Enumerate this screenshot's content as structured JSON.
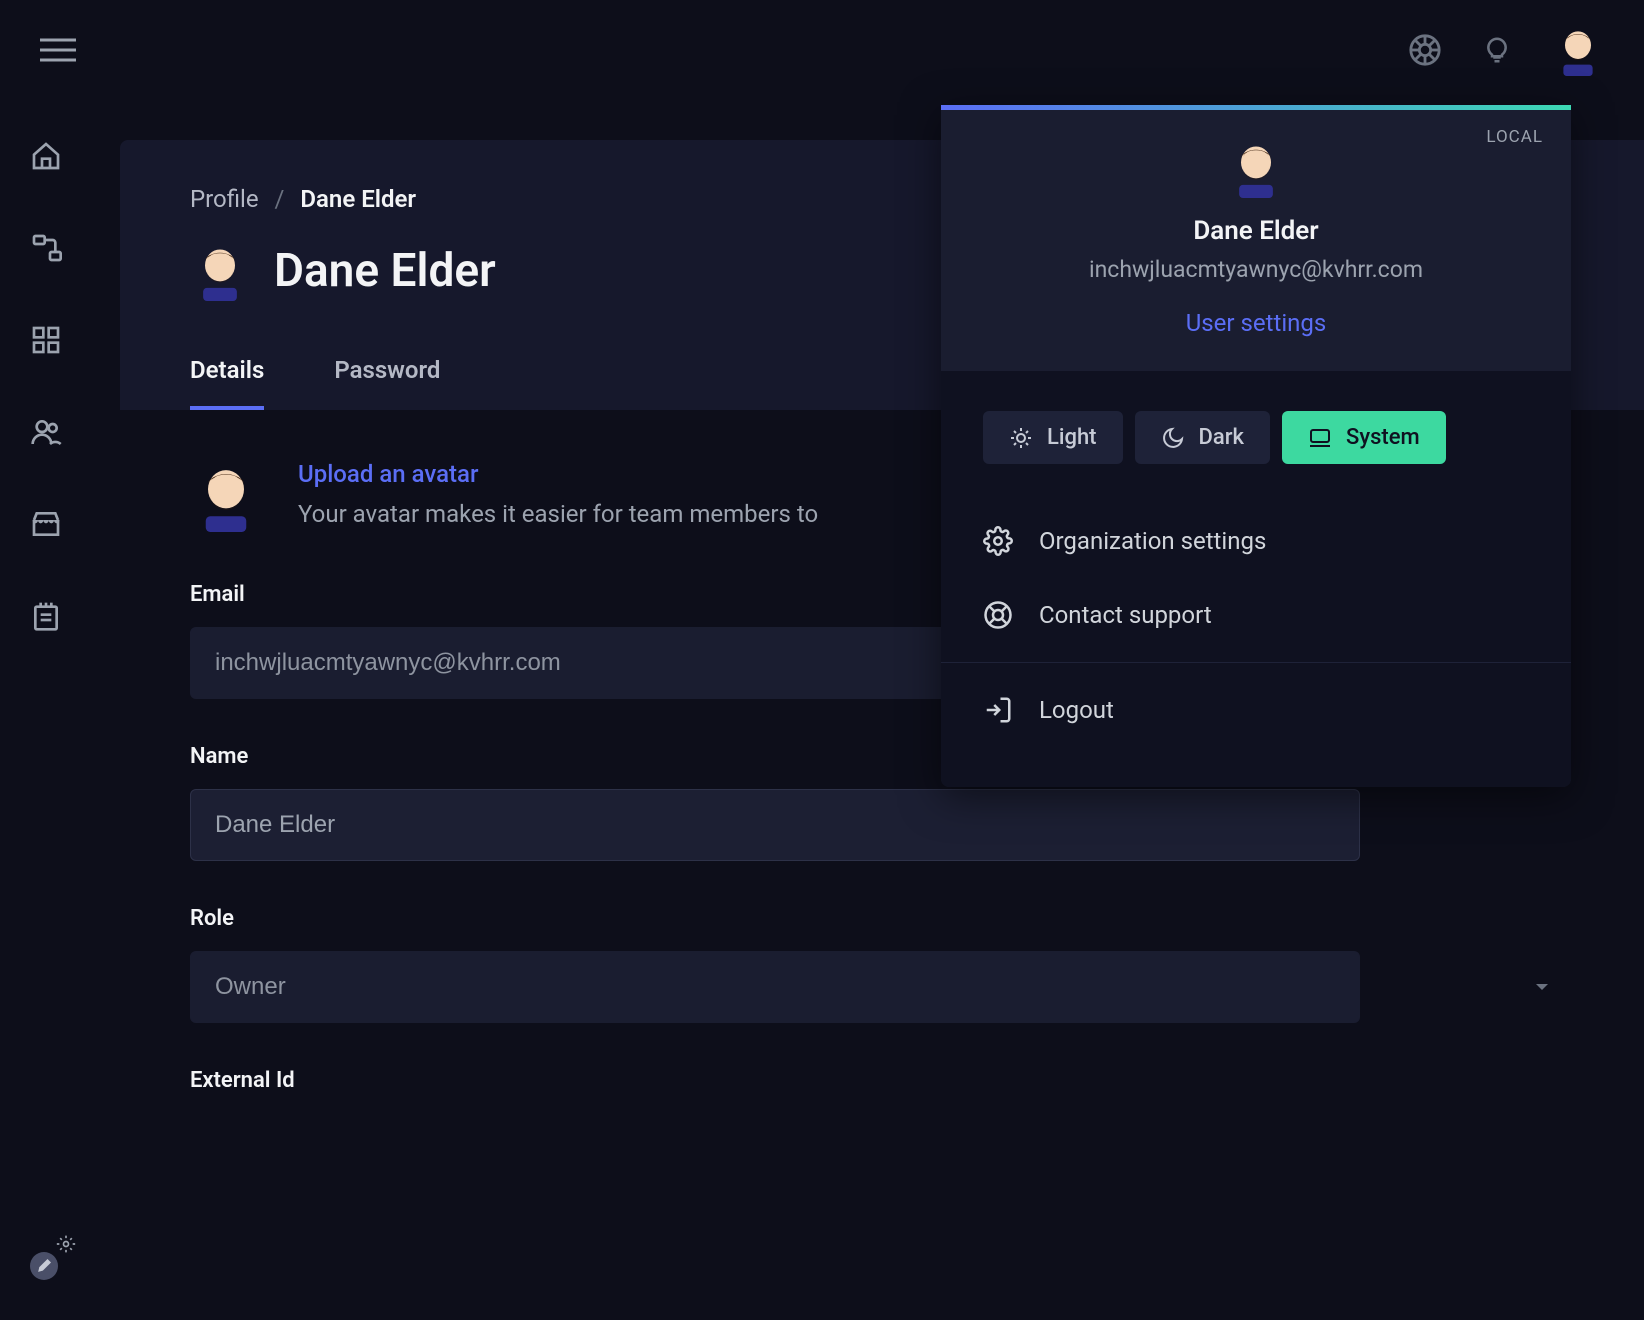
{
  "breadcrumb": {
    "root": "Profile",
    "current": "Dane Elder"
  },
  "page_title": "Dane Elder",
  "tabs": {
    "details": "Details",
    "password": "Password",
    "active": "details"
  },
  "avatar_section": {
    "upload_link": "Upload an avatar",
    "description": "Your avatar makes it easier for team members to"
  },
  "fields": {
    "email": {
      "label": "Email",
      "value": "inchwjluacmtyawnyc@kvhrr.com"
    },
    "name": {
      "label": "Name",
      "value": "Dane Elder"
    },
    "role": {
      "label": "Role",
      "value": "Owner"
    },
    "external_id": {
      "label": "External Id"
    }
  },
  "user_menu": {
    "env_badge": "LOCAL",
    "name": "Dane Elder",
    "email": "inchwjluacmtyawnyc@kvhrr.com",
    "settings_link": "User settings",
    "theme": {
      "light": "Light",
      "dark": "Dark",
      "system": "System",
      "active": "system"
    },
    "org_settings": "Organization settings",
    "support": "Contact support",
    "logout": "Logout"
  }
}
